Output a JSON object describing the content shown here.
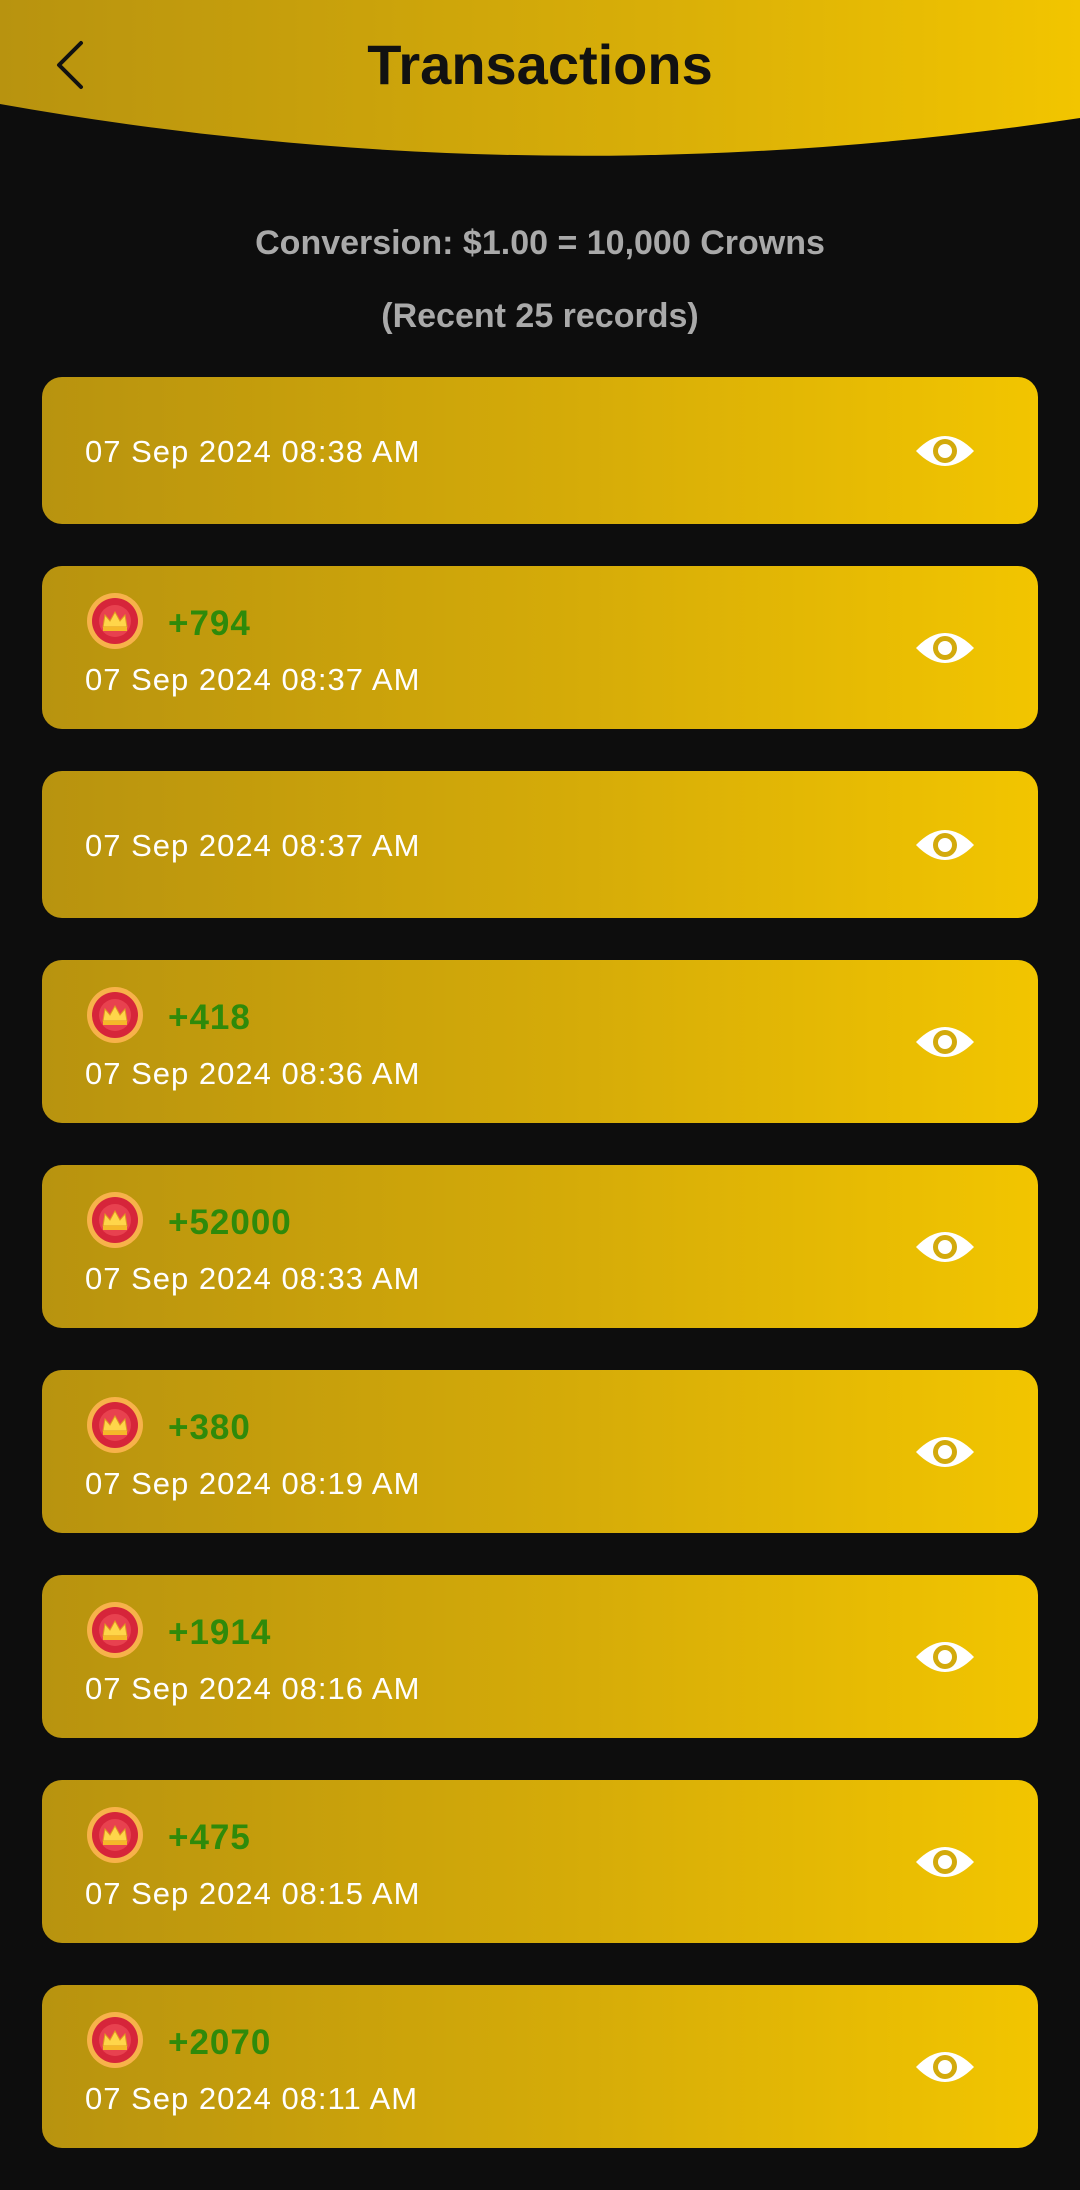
{
  "header": {
    "title": "Transactions",
    "back_icon": "chevron-left-icon"
  },
  "info": {
    "conversion": "Conversion: $1.00 = 10,000 Crowns",
    "recent": "(Recent 25 records)"
  },
  "colors": {
    "header_gold": "#d4aa0a",
    "card_start": "#b8930f",
    "card_end": "#f2c500",
    "amount_green": "#2f8a0a",
    "background": "#0d0d0d"
  },
  "transactions": [
    {
      "amount": "",
      "date": "07 Sep 2024 08:38 AM",
      "icon": "crown-badge-icon",
      "action_icon": "eye-icon"
    },
    {
      "amount": "+794",
      "date": "07 Sep 2024 08:37 AM",
      "icon": "crown-badge-icon",
      "action_icon": "eye-icon"
    },
    {
      "amount": "",
      "date": "07 Sep 2024 08:37 AM",
      "icon": "crown-badge-icon",
      "action_icon": "eye-icon"
    },
    {
      "amount": "+418",
      "date": "07 Sep 2024 08:36 AM",
      "icon": "crown-badge-icon",
      "action_icon": "eye-icon"
    },
    {
      "amount": "+52000",
      "date": "07 Sep 2024 08:33 AM",
      "icon": "crown-badge-icon",
      "action_icon": "eye-icon"
    },
    {
      "amount": "+380",
      "date": "07 Sep 2024 08:19 AM",
      "icon": "crown-badge-icon",
      "action_icon": "eye-icon"
    },
    {
      "amount": "+1914",
      "date": "07 Sep 2024 08:16 AM",
      "icon": "crown-badge-icon",
      "action_icon": "eye-icon"
    },
    {
      "amount": "+475",
      "date": "07 Sep 2024 08:15 AM",
      "icon": "crown-badge-icon",
      "action_icon": "eye-icon"
    },
    {
      "amount": "+2070",
      "date": "07 Sep 2024 08:11 AM",
      "icon": "crown-badge-icon",
      "action_icon": "eye-icon"
    }
  ]
}
